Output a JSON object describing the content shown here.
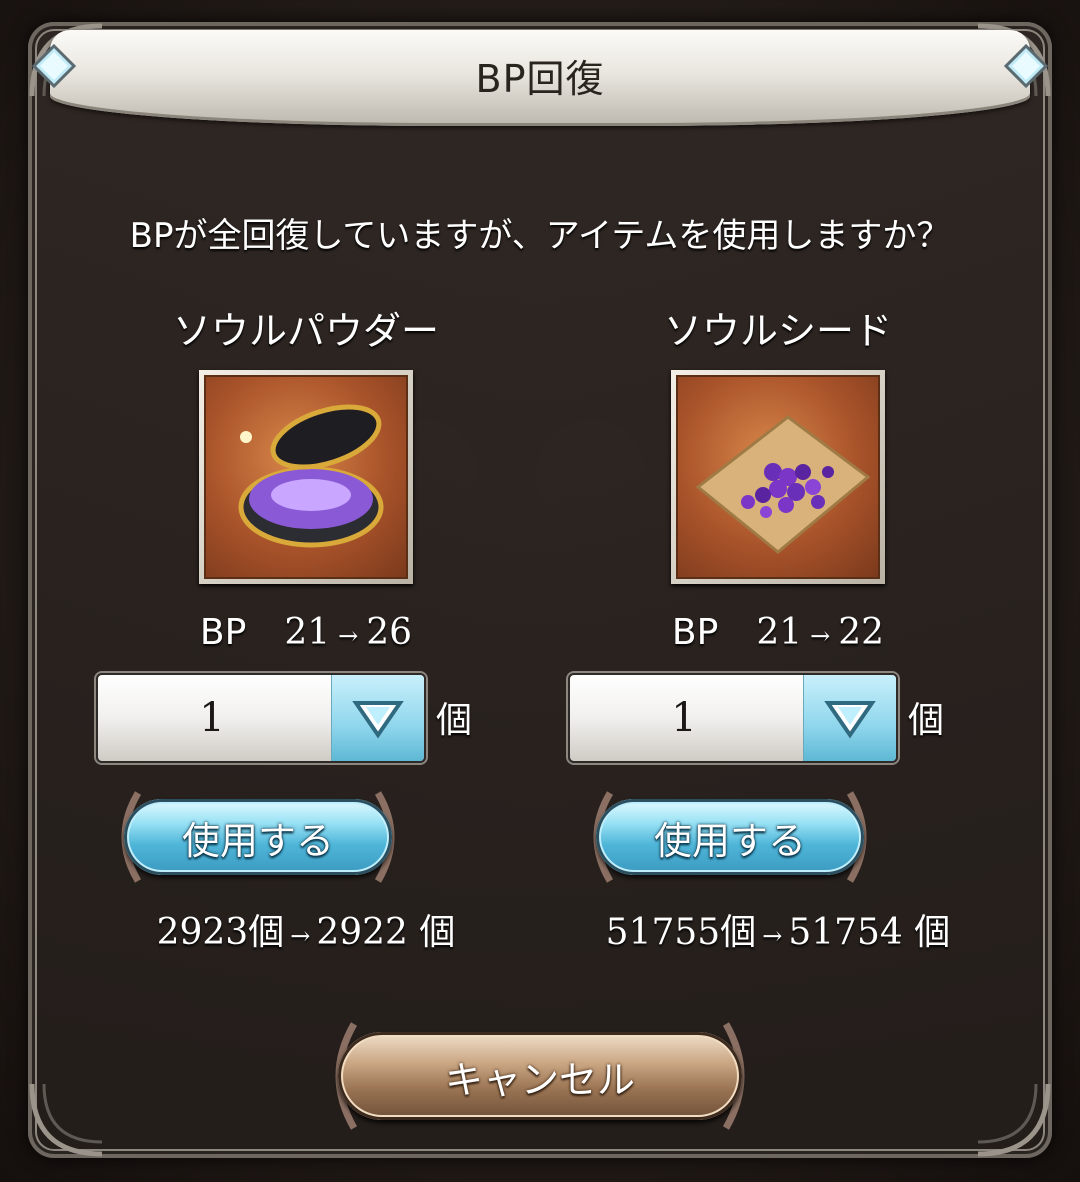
{
  "dialog": {
    "title": "BP回復",
    "question": "BPが全回復していますが、アイテムを使用しますか？"
  },
  "items": [
    {
      "name": "ソウルパウダー",
      "icon": "soul-powder-icon",
      "bp_label": "BP",
      "bp_from": "21",
      "bp_to": "26",
      "arrow": "→",
      "quantity": "1",
      "quantity_unit": "個",
      "use_label": "使用する",
      "stock_from": "2923個",
      "stock_to": "2922",
      "stock_unit": "個"
    },
    {
      "name": "ソウルシード",
      "icon": "soul-seed-icon",
      "bp_label": "BP",
      "bp_from": "21",
      "bp_to": "22",
      "arrow": "→",
      "quantity": "1",
      "quantity_unit": "個",
      "use_label": "使用する",
      "stock_from": "51755個",
      "stock_to": "51754",
      "stock_unit": "個"
    }
  ],
  "cancel_label": "キャンセル",
  "colors": {
    "use_button": "#4fb6d9",
    "cancel_button": "#9a7453",
    "title_bar": "#e9e6df"
  }
}
